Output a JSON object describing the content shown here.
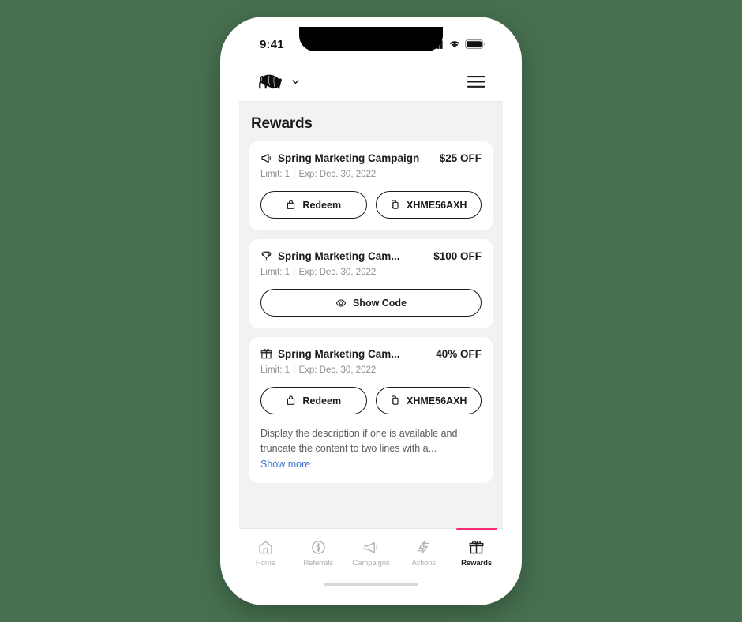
{
  "theme": {
    "page_background": "#477050",
    "accent_pink": "#ff2d6f",
    "link_blue": "#3c6fd0",
    "content_background": "#f2f2f3",
    "card_background": "#ffffff",
    "text_primary": "#1c1c1e",
    "text_muted": "#8e8e93"
  },
  "status_bar": {
    "time": "9:41",
    "cellular_icon": "cellular-signal-icon",
    "wifi_icon": "wifi-icon",
    "battery_icon": "battery-full-icon"
  },
  "header": {
    "logo_icon": "bear-logo-icon",
    "dropdown_icon": "chevron-down-icon",
    "menu_icon": "hamburger-menu-icon"
  },
  "main": {
    "title": "Rewards",
    "cards": [
      {
        "icon": "megaphone-icon",
        "title": "Spring Marketing Campaign",
        "discount": "$25 OFF",
        "limit_label": "Limit: 1",
        "separator": "|",
        "expiry_label": "Exp: Dec. 30, 2022",
        "buttons": [
          {
            "icon": "shopping-bag-icon",
            "label": "Redeem",
            "name": "redeem-button"
          },
          {
            "icon": "copy-icon",
            "label": "XHME56AXH",
            "name": "copy-code-button"
          }
        ],
        "description": null,
        "show_more_label": null
      },
      {
        "icon": "trophy-icon",
        "title": "Spring Marketing Cam...",
        "discount": "$100 OFF",
        "limit_label": "Limit: 1",
        "separator": "|",
        "expiry_label": "Exp: Dec. 30, 2022",
        "buttons": [
          {
            "icon": "eye-icon",
            "label": "Show Code",
            "name": "show-code-button"
          }
        ],
        "description": null,
        "show_more_label": null
      },
      {
        "icon": "gift-icon",
        "title": "Spring Marketing Cam...",
        "discount": "40% OFF",
        "limit_label": "Limit: 1",
        "separator": "|",
        "expiry_label": "Exp: Dec. 30, 2022",
        "buttons": [
          {
            "icon": "shopping-bag-icon",
            "label": "Redeem",
            "name": "redeem-button"
          },
          {
            "icon": "copy-icon",
            "label": "XHME56AXH",
            "name": "copy-code-button"
          }
        ],
        "description": "Display the description if one is available and truncate the content to two lines with a...",
        "show_more_label": "Show more"
      }
    ]
  },
  "bottom_nav": {
    "items": [
      {
        "label": "Home",
        "icon": "home-icon",
        "active": false
      },
      {
        "label": "Referrals",
        "icon": "dollar-circle-icon",
        "active": false
      },
      {
        "label": "Campaigns",
        "icon": "megaphone-icon",
        "active": false
      },
      {
        "label": "Actions",
        "icon": "lightning-bolt-icon",
        "active": false
      },
      {
        "label": "Rewards",
        "icon": "gift-icon",
        "active": true
      }
    ]
  },
  "home_indicator": "home-indicator-bar"
}
